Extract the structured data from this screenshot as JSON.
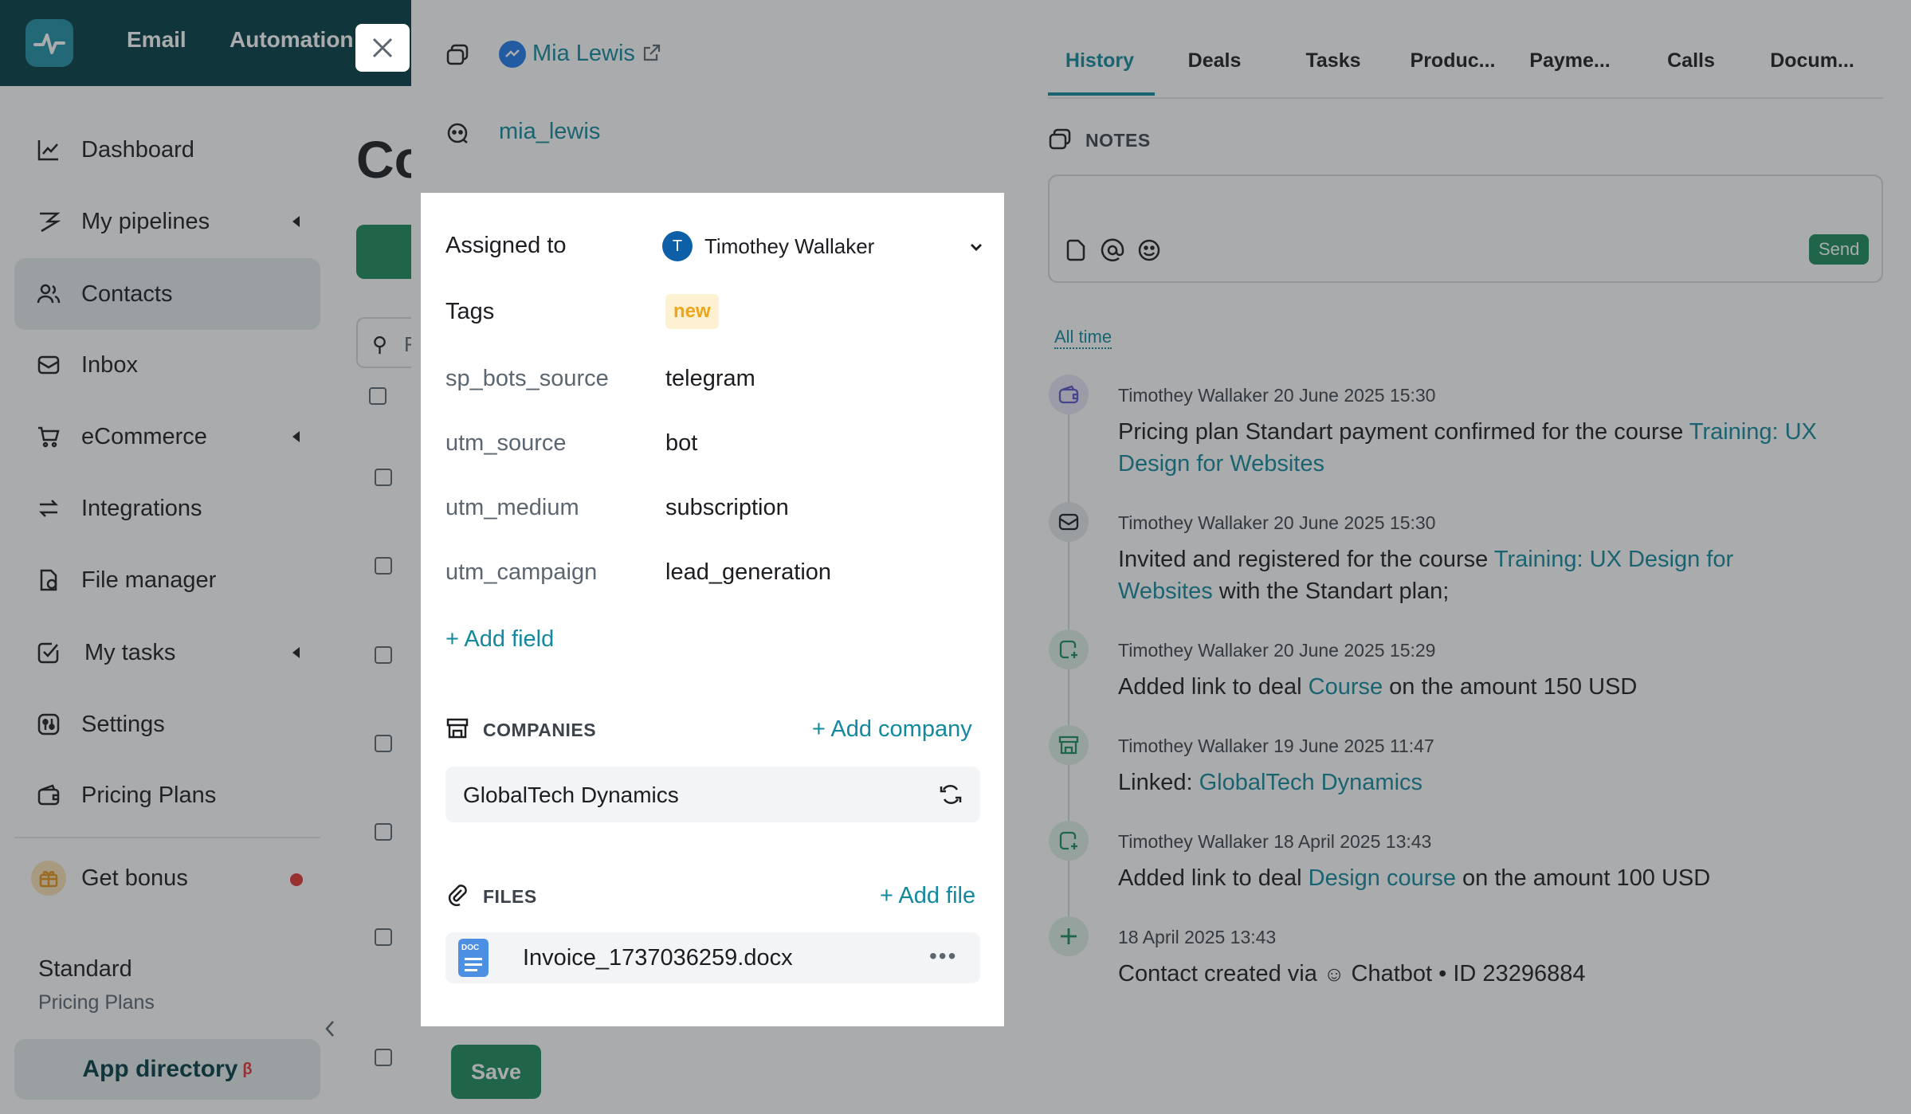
{
  "topbar": {
    "nav": [
      "Email",
      "Automation"
    ]
  },
  "sidebar": {
    "items": [
      {
        "label": "Dashboard",
        "icon": "chart-line-icon"
      },
      {
        "label": "My pipelines",
        "icon": "pipeline-icon"
      },
      {
        "label": "Contacts",
        "icon": "contacts-icon"
      },
      {
        "label": "Inbox",
        "icon": "inbox-icon"
      },
      {
        "label": "eCommerce",
        "icon": "cart-icon"
      },
      {
        "label": "Integrations",
        "icon": "arrows-icon"
      },
      {
        "label": "File manager",
        "icon": "file-icon"
      },
      {
        "label": "My tasks",
        "icon": "check-icon"
      },
      {
        "label": "Settings",
        "icon": "settings-icon"
      },
      {
        "label": "Pricing Plans",
        "icon": "wallet-icon"
      },
      {
        "label": "Get bonus",
        "icon": "gift-icon"
      }
    ],
    "plan_name": "Standard",
    "plan_sub": "Pricing Plans",
    "app_directory": "App directory",
    "beta": "β"
  },
  "main": {
    "title": "Co",
    "search": "F"
  },
  "contact": {
    "messenger_name": "Mia Lewis",
    "username": "mia_lewis"
  },
  "fields": {
    "assigned_label": "Assigned to",
    "assigned_initial": "T",
    "assigned_value": "Timothey Wallaker",
    "tags_label": "Tags",
    "tag": "new",
    "rows": [
      {
        "label": "sp_bots_source",
        "value": "telegram"
      },
      {
        "label": "utm_source",
        "value": "bot"
      },
      {
        "label": "utm_medium",
        "value": "subscription"
      },
      {
        "label": "utm_campaign",
        "value": "lead_generation"
      }
    ],
    "add_field": "+ Add field"
  },
  "companies": {
    "title": "COMPANIES",
    "add": "+ Add company",
    "name": "GlobalTech Dynamics"
  },
  "files": {
    "title": "FILES",
    "add": "+ Add file",
    "file_name": "Invoice_1737036259.docx",
    "doc_badge": "DOC"
  },
  "save": "Save",
  "tabs": [
    "History",
    "Deals",
    "Tasks",
    "Produc...",
    "Payme...",
    "Calls",
    "Docum..."
  ],
  "notes": {
    "title": "NOTES",
    "send": "Send"
  },
  "filter": "All time",
  "history": [
    {
      "meta": "Timothey Wallaker  20 June 2025 15:30",
      "pre": "Pricing plan Standart payment confirmed for the course ",
      "link": "Training: UX",
      "text2_link": "Design for Websites",
      "post": ""
    },
    {
      "meta": "Timothey Wallaker  20 June 2025 15:30",
      "pre": "Invited and registered for the course ",
      "link": "Training: UX Design for",
      "text2_link": "Websites",
      "post": " with the Standart plan;"
    },
    {
      "meta": "Timothey Wallaker  20 June 2025 15:29",
      "pre": "Added link to deal ",
      "link": "Course",
      "post": " on the amount 150 USD"
    },
    {
      "meta": "Timothey Wallaker  19 June 2025 11:47",
      "pre": "Linked: ",
      "link": "GlobalTech Dynamics",
      "post": ""
    },
    {
      "meta": "Timothey Wallaker  18 April 2025 13:43",
      "pre": "Added link to deal ",
      "link": "Design course",
      "post": " on the amount 100 USD"
    },
    {
      "meta": "18 April 2025 13:43",
      "pre": "Contact created via ",
      "link": "Chatbot",
      "post": " • ID 23296884"
    }
  ],
  "colors": {
    "brand": "#003b43",
    "accent": "#12899e",
    "green": "#1a8a5c"
  }
}
